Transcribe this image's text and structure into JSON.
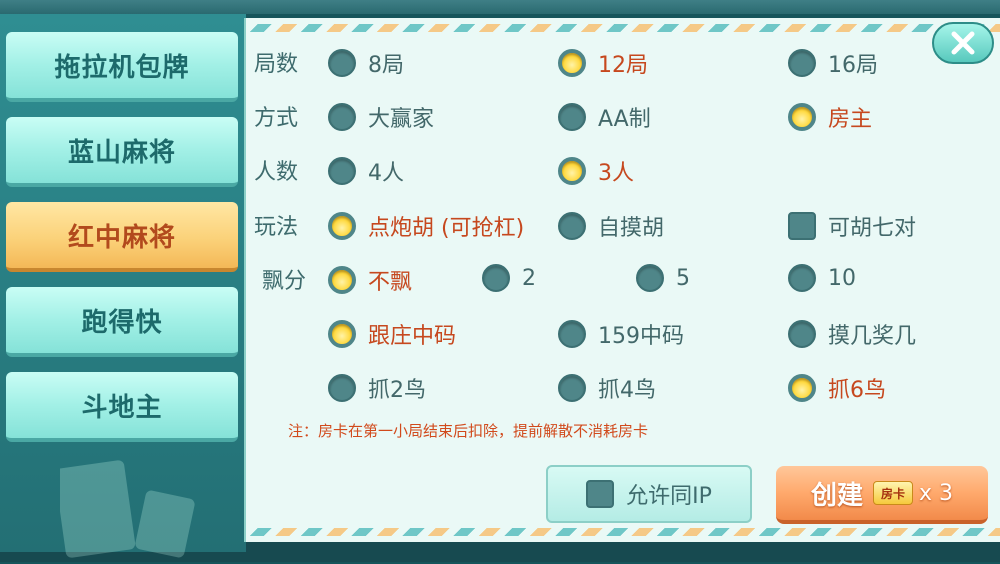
{
  "sidebar": {
    "items": [
      {
        "label": "拖拉机包牌",
        "active": false
      },
      {
        "label": "蓝山麻将",
        "active": false
      },
      {
        "label": "红中麻将",
        "active": true
      },
      {
        "label": "跑得快",
        "active": false
      },
      {
        "label": "斗地主",
        "active": false
      }
    ]
  },
  "rows": {
    "rounds": {
      "label": "局数",
      "options": [
        "8局",
        "12局",
        "16局"
      ],
      "selected": "12局"
    },
    "payment": {
      "label": "方式",
      "options": [
        "大赢家",
        "AA制",
        "房主"
      ],
      "selected": "房主"
    },
    "players": {
      "label": "人数",
      "options": [
        "4人",
        "3人"
      ],
      "selected": "3人"
    },
    "play": {
      "label": "玩法",
      "options": [
        "点炮胡 (可抢杠)",
        "自摸胡"
      ],
      "selected": "点炮胡 (可抢杠)",
      "checkbox": "可胡七对",
      "checkbox_checked": false
    },
    "float": {
      "label": "飘分",
      "options": [
        "不飘",
        "2",
        "5",
        "10"
      ],
      "selected": "不飘"
    },
    "code": {
      "options": [
        "跟庄中码",
        "159中码",
        "摸几奖几"
      ],
      "selected": "跟庄中码"
    },
    "bird": {
      "options": [
        "抓2鸟",
        "抓4鸟",
        "抓6鸟"
      ],
      "selected": "抓6鸟"
    }
  },
  "note": "注：房卡在第一小局结束后扣除，提前解散不消耗房卡",
  "allow_same_ip": {
    "label": "允许同IP",
    "checked": false
  },
  "create": {
    "label": "创建",
    "card_badge": "房卡",
    "count": "x 3"
  },
  "icons": {
    "close": "close-icon",
    "card": "room-card-icon"
  },
  "colors": {
    "selected_text": "#c6481e",
    "accent_gold": "#ffd83b",
    "teal": "#4f8689"
  }
}
